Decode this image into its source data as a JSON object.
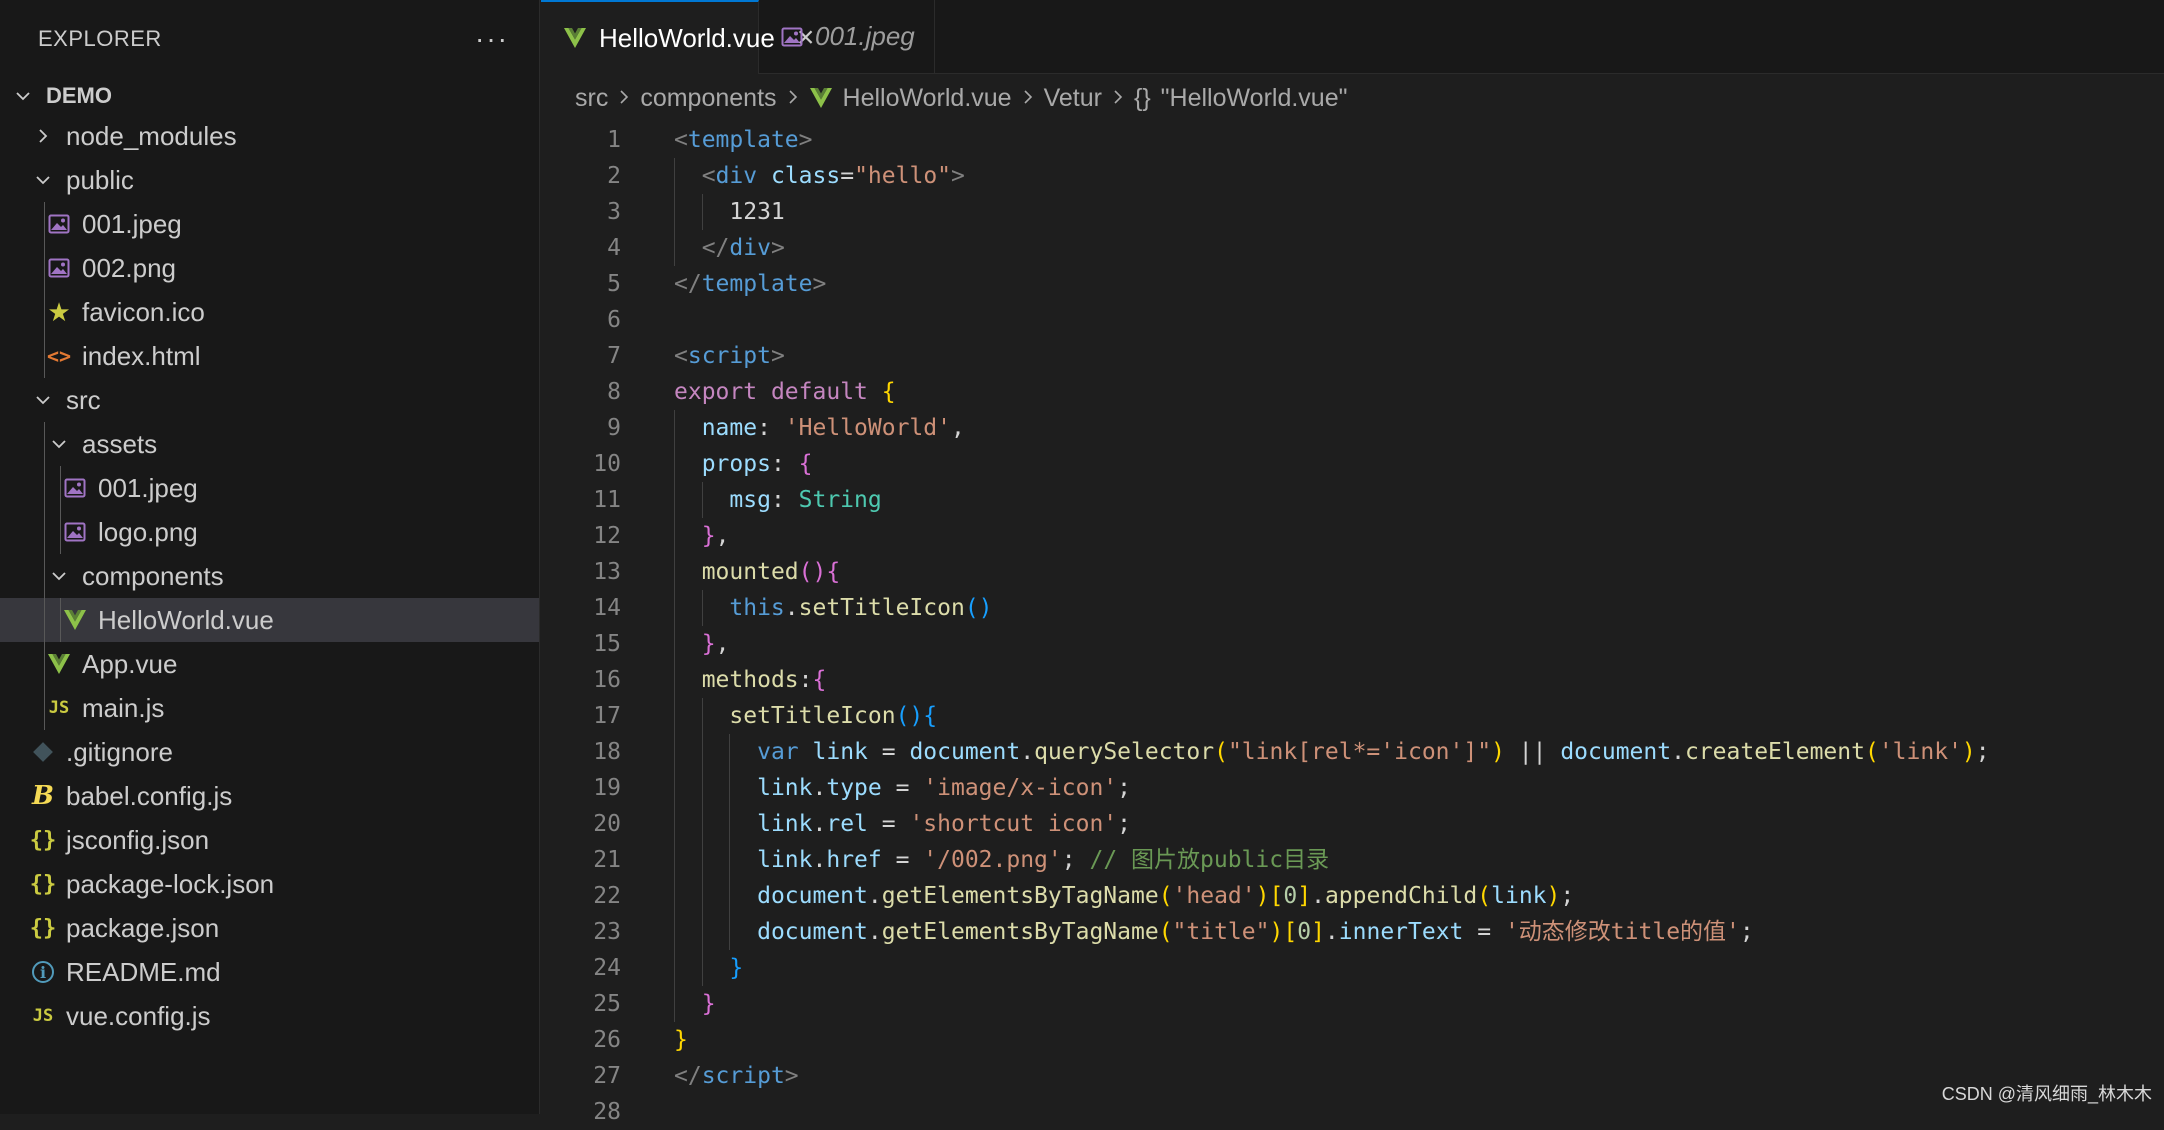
{
  "explorer": {
    "title": "EXPLORER",
    "more": "···",
    "section": "DEMO",
    "items": [
      {
        "label": "node_modules",
        "icon": "chevron-right-icon",
        "depth": 1
      },
      {
        "label": "public",
        "icon": "chevron-down-icon",
        "depth": 1
      },
      {
        "label": "001.jpeg",
        "icon": "image-icon",
        "depth": 2
      },
      {
        "label": "002.png",
        "icon": "image-icon",
        "depth": 2
      },
      {
        "label": "favicon.ico",
        "icon": "star-icon",
        "depth": 2
      },
      {
        "label": "index.html",
        "icon": "html-icon",
        "depth": 2
      },
      {
        "label": "src",
        "icon": "chevron-down-icon",
        "depth": 1
      },
      {
        "label": "assets",
        "icon": "chevron-down-icon",
        "depth": 2
      },
      {
        "label": "001.jpeg",
        "icon": "image-icon",
        "depth": 3
      },
      {
        "label": "logo.png",
        "icon": "image-icon",
        "depth": 3
      },
      {
        "label": "components",
        "icon": "chevron-down-icon",
        "depth": 2
      },
      {
        "label": "HelloWorld.vue",
        "icon": "vue-icon",
        "depth": 3,
        "selected": true
      },
      {
        "label": "App.vue",
        "icon": "vue-icon",
        "depth": 2
      },
      {
        "label": "main.js",
        "icon": "js-icon",
        "depth": 2
      },
      {
        "label": ".gitignore",
        "icon": "git-icon",
        "depth": 1
      },
      {
        "label": "babel.config.js",
        "icon": "babel-icon",
        "depth": 1
      },
      {
        "label": "jsconfig.json",
        "icon": "json-icon",
        "depth": 1
      },
      {
        "label": "package-lock.json",
        "icon": "json-icon",
        "depth": 1
      },
      {
        "label": "package.json",
        "icon": "json-icon",
        "depth": 1
      },
      {
        "label": "README.md",
        "icon": "info-icon",
        "depth": 1
      },
      {
        "label": "vue.config.js",
        "icon": "js-icon",
        "depth": 1
      }
    ]
  },
  "tabs": [
    {
      "label": "HelloWorld.vue",
      "icon": "vue-icon",
      "active": true
    },
    {
      "label": "001.jpeg",
      "icon": "image-icon",
      "active": false
    }
  ],
  "breadcrumb": {
    "items": [
      "src",
      "components",
      "HelloWorld.vue",
      "Vetur",
      "\"HelloWorld.vue\""
    ],
    "vetur_braces": "{}"
  },
  "editor": {
    "lines": [
      {
        "n": "1",
        "indent": 0,
        "tokens": [
          [
            "t-punc",
            "<"
          ],
          [
            "t-tag",
            "template"
          ],
          [
            "t-punc",
            ">"
          ]
        ]
      },
      {
        "n": "2",
        "indent": 1,
        "tokens": [
          [
            "t-punc",
            "<"
          ],
          [
            "t-tag",
            "div"
          ],
          [
            "t-plain",
            " "
          ],
          [
            "t-attr",
            "class"
          ],
          [
            "t-plain",
            "="
          ],
          [
            "t-str",
            "\"hello\""
          ],
          [
            "t-punc",
            ">"
          ]
        ]
      },
      {
        "n": "3",
        "indent": 2,
        "tokens": [
          [
            "t-plain",
            "1231"
          ]
        ]
      },
      {
        "n": "4",
        "indent": 1,
        "tokens": [
          [
            "t-punc",
            "</"
          ],
          [
            "t-tag",
            "div"
          ],
          [
            "t-punc",
            ">"
          ]
        ]
      },
      {
        "n": "5",
        "indent": 0,
        "tokens": [
          [
            "t-punc",
            "</"
          ],
          [
            "t-tag",
            "template"
          ],
          [
            "t-punc",
            ">"
          ]
        ]
      },
      {
        "n": "6",
        "indent": 0,
        "tokens": []
      },
      {
        "n": "7",
        "indent": 0,
        "tokens": [
          [
            "t-punc",
            "<"
          ],
          [
            "t-tag",
            "script"
          ],
          [
            "t-punc",
            ">"
          ]
        ]
      },
      {
        "n": "8",
        "indent": 0,
        "tokens": [
          [
            "t-kw",
            "export"
          ],
          [
            "t-plain",
            " "
          ],
          [
            "t-kw",
            "default"
          ],
          [
            "t-plain",
            " "
          ],
          [
            "t-b1",
            "{"
          ]
        ]
      },
      {
        "n": "9",
        "indent": 1,
        "tokens": [
          [
            "t-var",
            "name"
          ],
          [
            "t-plain",
            ": "
          ],
          [
            "t-str",
            "'HelloWorld'"
          ],
          [
            "t-plain",
            ","
          ]
        ]
      },
      {
        "n": "10",
        "indent": 1,
        "tokens": [
          [
            "t-var",
            "props"
          ],
          [
            "t-plain",
            ": "
          ],
          [
            "t-b2",
            "{"
          ]
        ]
      },
      {
        "n": "11",
        "indent": 2,
        "tokens": [
          [
            "t-var",
            "msg"
          ],
          [
            "t-plain",
            ": "
          ],
          [
            "t-type",
            "String"
          ]
        ]
      },
      {
        "n": "12",
        "indent": 1,
        "tokens": [
          [
            "t-b2",
            "}"
          ],
          [
            "t-plain",
            ","
          ]
        ]
      },
      {
        "n": "13",
        "indent": 1,
        "tokens": [
          [
            "t-fn",
            "mounted"
          ],
          [
            "t-b2",
            "()"
          ],
          [
            "t-b2",
            "{"
          ]
        ]
      },
      {
        "n": "14",
        "indent": 2,
        "tokens": [
          [
            "t-this",
            "this"
          ],
          [
            "t-plain",
            "."
          ],
          [
            "t-fn",
            "setTitleIcon"
          ],
          [
            "t-b3",
            "()"
          ]
        ]
      },
      {
        "n": "15",
        "indent": 1,
        "tokens": [
          [
            "t-b2",
            "}"
          ],
          [
            "t-plain",
            ","
          ]
        ]
      },
      {
        "n": "16",
        "indent": 1,
        "tokens": [
          [
            "t-fn",
            "methods"
          ],
          [
            "t-plain",
            ":"
          ],
          [
            "t-b2",
            "{"
          ]
        ]
      },
      {
        "n": "17",
        "indent": 2,
        "tokens": [
          [
            "t-fn",
            "setTitleIcon"
          ],
          [
            "t-b3",
            "()"
          ],
          [
            "t-b3",
            "{"
          ]
        ]
      },
      {
        "n": "18",
        "indent": 3,
        "tokens": [
          [
            "t-this",
            "var"
          ],
          [
            "t-plain",
            " "
          ],
          [
            "t-var",
            "link"
          ],
          [
            "t-plain",
            " = "
          ],
          [
            "t-var",
            "document"
          ],
          [
            "t-plain",
            "."
          ],
          [
            "t-fn",
            "querySelector"
          ],
          [
            "t-b1",
            "("
          ],
          [
            "t-str",
            "\"link[rel*='icon']\""
          ],
          [
            "t-b1",
            ")"
          ],
          [
            "t-plain",
            " || "
          ],
          [
            "t-var",
            "document"
          ],
          [
            "t-plain",
            "."
          ],
          [
            "t-fn",
            "createElement"
          ],
          [
            "t-b1",
            "("
          ],
          [
            "t-str",
            "'link'"
          ],
          [
            "t-b1",
            ")"
          ],
          [
            "t-plain",
            ";"
          ]
        ]
      },
      {
        "n": "19",
        "indent": 3,
        "tokens": [
          [
            "t-var",
            "link"
          ],
          [
            "t-plain",
            "."
          ],
          [
            "t-var",
            "type"
          ],
          [
            "t-plain",
            " = "
          ],
          [
            "t-str",
            "'image/x-icon'"
          ],
          [
            "t-plain",
            ";"
          ]
        ]
      },
      {
        "n": "20",
        "indent": 3,
        "tokens": [
          [
            "t-var",
            "link"
          ],
          [
            "t-plain",
            "."
          ],
          [
            "t-var",
            "rel"
          ],
          [
            "t-plain",
            " = "
          ],
          [
            "t-str",
            "'shortcut icon'"
          ],
          [
            "t-plain",
            ";"
          ]
        ]
      },
      {
        "n": "21",
        "indent": 3,
        "tokens": [
          [
            "t-var",
            "link"
          ],
          [
            "t-plain",
            "."
          ],
          [
            "t-var",
            "href"
          ],
          [
            "t-plain",
            " = "
          ],
          [
            "t-str",
            "'/002.png'"
          ],
          [
            "t-plain",
            "; "
          ],
          [
            "t-com",
            "// 图片放public目录"
          ]
        ]
      },
      {
        "n": "22",
        "indent": 3,
        "tokens": [
          [
            "t-var",
            "document"
          ],
          [
            "t-plain",
            "."
          ],
          [
            "t-fn",
            "getElementsByTagName"
          ],
          [
            "t-b1",
            "("
          ],
          [
            "t-str",
            "'head'"
          ],
          [
            "t-b1",
            ")"
          ],
          [
            "t-b1",
            "["
          ],
          [
            "t-num",
            "0"
          ],
          [
            "t-b1",
            "]"
          ],
          [
            "t-plain",
            "."
          ],
          [
            "t-fn",
            "appendChild"
          ],
          [
            "t-b1",
            "("
          ],
          [
            "t-var",
            "link"
          ],
          [
            "t-b1",
            ")"
          ],
          [
            "t-plain",
            ";"
          ]
        ]
      },
      {
        "n": "23",
        "indent": 3,
        "tokens": [
          [
            "t-var",
            "document"
          ],
          [
            "t-plain",
            "."
          ],
          [
            "t-fn",
            "getElementsByTagName"
          ],
          [
            "t-b1",
            "("
          ],
          [
            "t-str",
            "\"title\""
          ],
          [
            "t-b1",
            ")"
          ],
          [
            "t-b1",
            "["
          ],
          [
            "t-num",
            "0"
          ],
          [
            "t-b1",
            "]"
          ],
          [
            "t-plain",
            "."
          ],
          [
            "t-var",
            "innerText"
          ],
          [
            "t-plain",
            " = "
          ],
          [
            "t-str",
            "'动态修改title的值'"
          ],
          [
            "t-plain",
            ";"
          ]
        ]
      },
      {
        "n": "24",
        "indent": 2,
        "tokens": [
          [
            "t-b3",
            "}"
          ]
        ]
      },
      {
        "n": "25",
        "indent": 1,
        "tokens": [
          [
            "t-b2",
            "}"
          ]
        ]
      },
      {
        "n": "26",
        "indent": 0,
        "tokens": [
          [
            "t-b1",
            "}"
          ]
        ]
      },
      {
        "n": "27",
        "indent": 0,
        "tokens": [
          [
            "t-punc",
            "</"
          ],
          [
            "t-tag",
            "script"
          ],
          [
            "t-punc",
            ">"
          ]
        ]
      },
      {
        "n": "28",
        "indent": 0,
        "tokens": []
      }
    ]
  },
  "watermark": "CSDN @清风细雨_林木木",
  "colors": {
    "sidebar_bg": "#181818",
    "editor_bg": "#1e1e1e",
    "selected_row": "#37373d",
    "active_tab_accent": "#0078d4",
    "vue_green": "#8dc149",
    "image_purple": "#a074c4"
  }
}
